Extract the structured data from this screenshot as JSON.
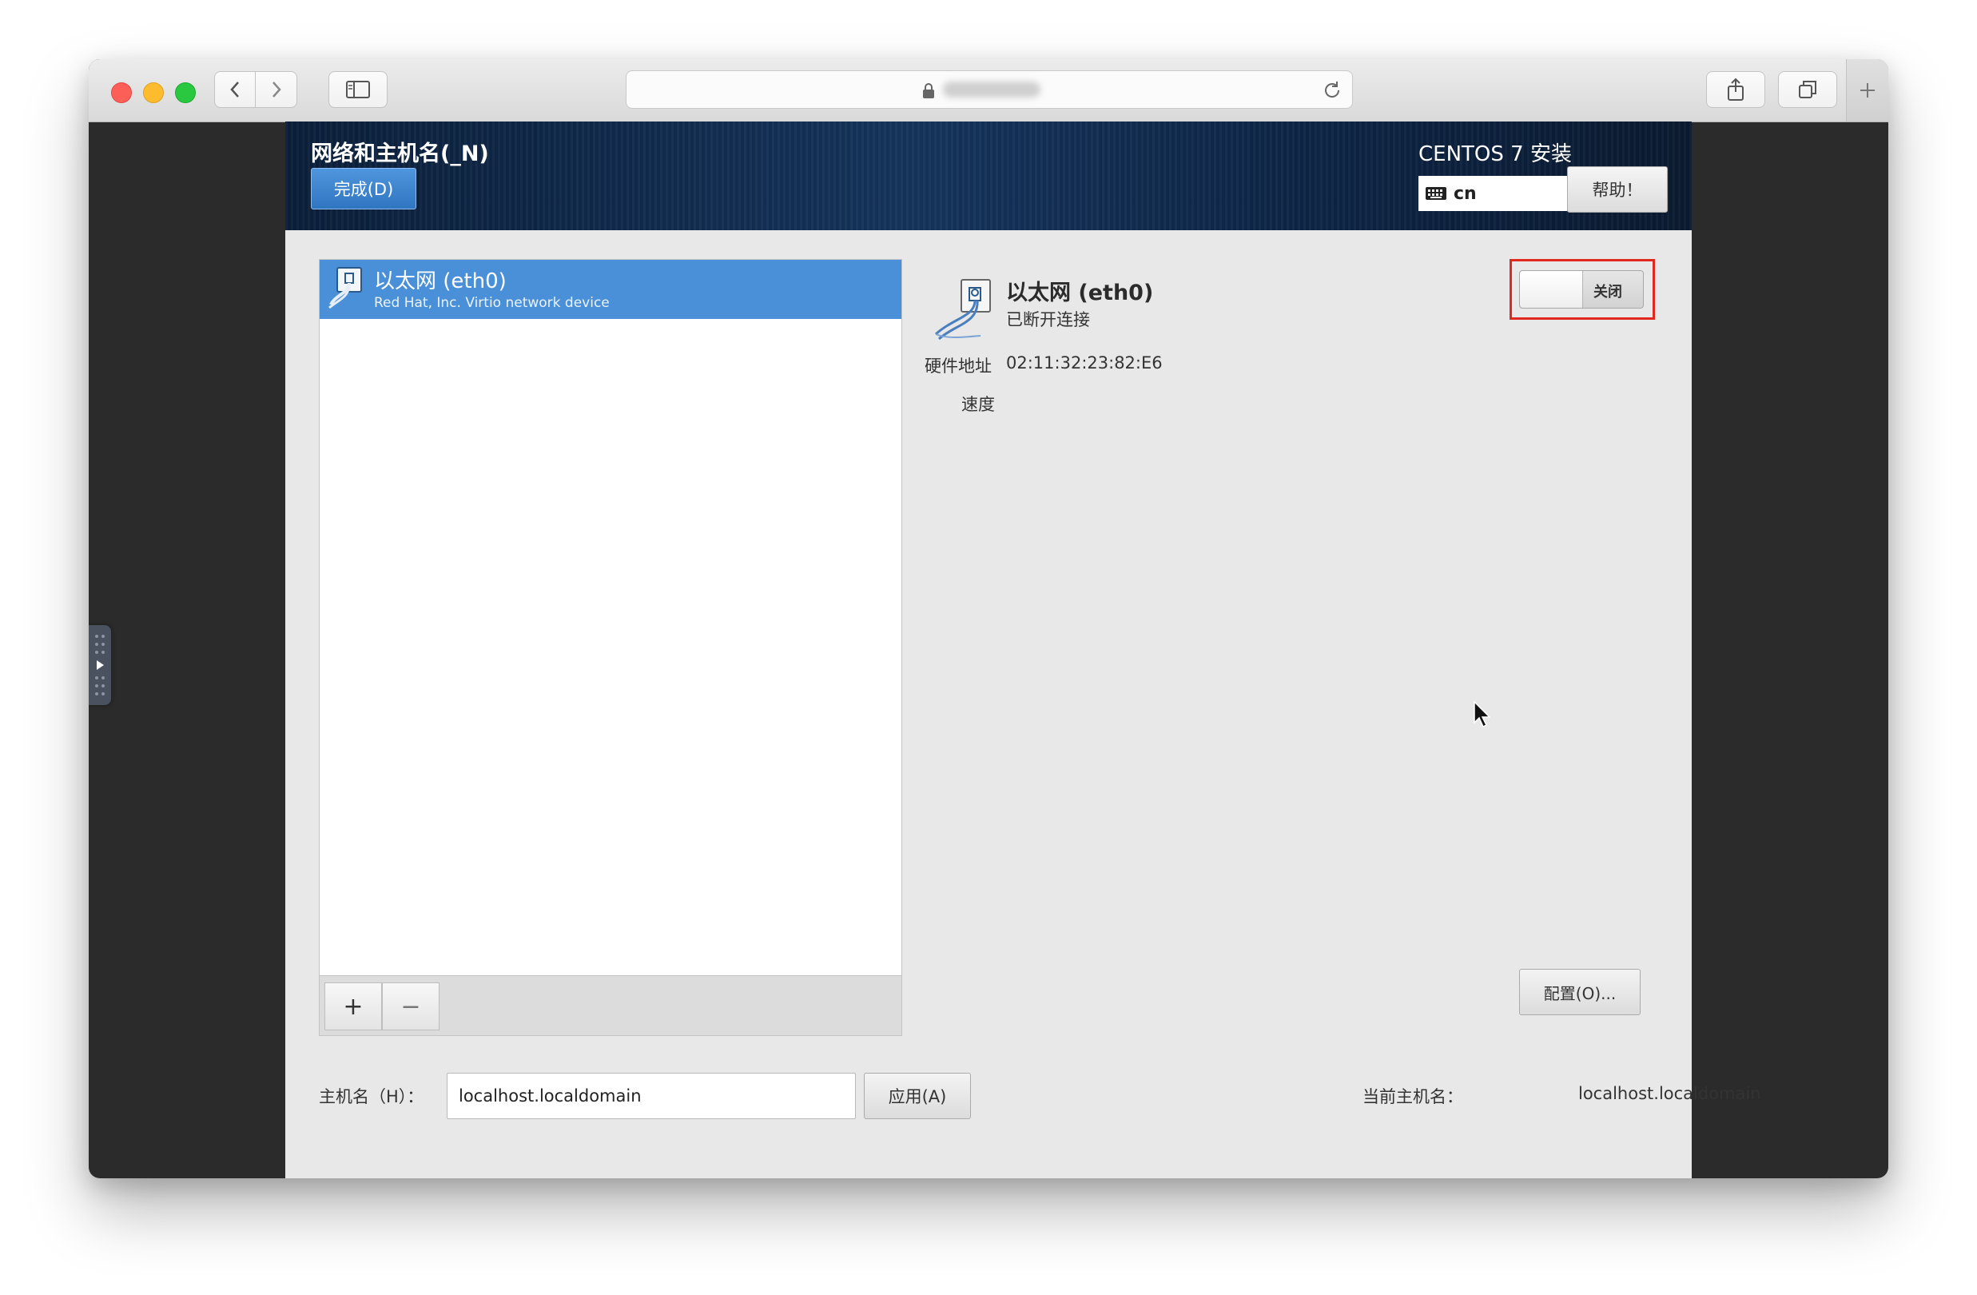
{
  "browser": {
    "address_bar_text": "",
    "colors": {
      "close": "#fc5f57",
      "minimize": "#fdbc2e",
      "zoom": "#29c840"
    }
  },
  "installer": {
    "spoke_title": "网络和主机名(_N)",
    "done_button": "完成(D)",
    "product_title": "CENTOS 7 安装",
    "keyboard_layout": "cn",
    "help_button": "帮助！",
    "accent_color": "#4a90d9"
  },
  "device_list": {
    "items": [
      {
        "name": "以太网 (eth0)",
        "description": "Red Hat, Inc. Virtio network device",
        "icon": "ethernet-cable-icon",
        "selected": true
      }
    ],
    "add_button": "+",
    "remove_button": "−"
  },
  "device_detail": {
    "name": "以太网 (eth0)",
    "status": "已断开连接",
    "hardware_address_label": "硬件地址",
    "hardware_address": "02:11:32:23:82:E6",
    "speed_label": "速度",
    "toggle_label": "关闭",
    "toggle_on": false,
    "configure_button": "配置(O)..."
  },
  "hostname": {
    "label": "主机名（H）：",
    "value": "localhost.localdomain",
    "apply_button": "应用(A)",
    "current_label": "当前主机名：",
    "current_value": "localhost.localdomain"
  }
}
